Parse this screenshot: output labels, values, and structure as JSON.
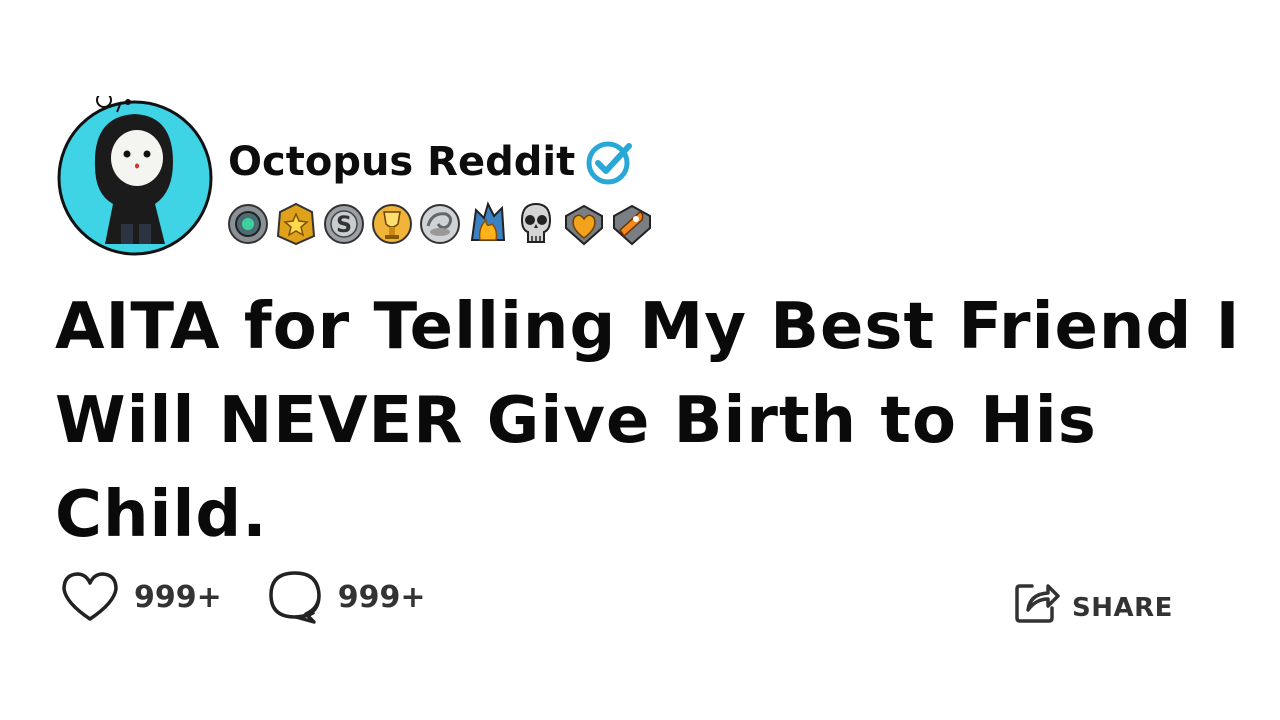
{
  "post": {
    "author": "Octopus Reddit",
    "verified": true,
    "title": "AITA for Telling My Best Friend I Will NEVER Give Birth to His Child."
  },
  "awards": [
    "green-gem-award",
    "gold-star-award",
    "silver-s-coin-award",
    "gold-trophy-award",
    "silver-swirl-award",
    "fire-award",
    "skull-award",
    "gold-heart-award",
    "rocket-award"
  ],
  "actions": {
    "likes": "999+",
    "comments": "999+",
    "share_label": "SHARE"
  },
  "colors": {
    "accent": "#29a8d8",
    "avatar_bg": "#3fd3e6",
    "text": "#0a0a0a",
    "muted": "#333333"
  }
}
